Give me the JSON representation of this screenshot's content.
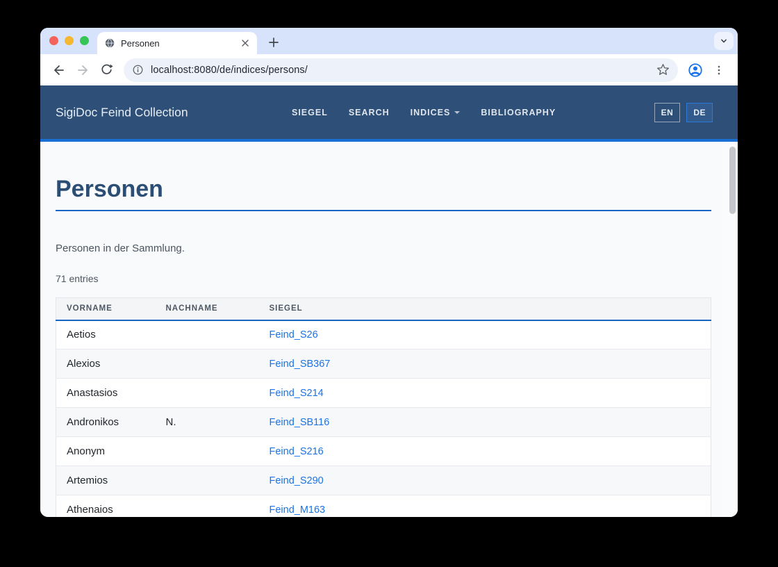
{
  "browser": {
    "tab_title": "Personen",
    "url": "localhost:8080/de/indices/persons/"
  },
  "site": {
    "brand": "SigiDoc Feind Collection",
    "nav": [
      {
        "label": "SIEGEL"
      },
      {
        "label": "SEARCH"
      },
      {
        "label": "INDICES",
        "has_dropdown": true
      },
      {
        "label": "BIBLIOGRAPHY"
      }
    ],
    "lang": [
      {
        "label": "EN",
        "active": false
      },
      {
        "label": "DE",
        "active": true
      }
    ]
  },
  "page": {
    "title": "Personen",
    "description": "Personen in der Sammlung.",
    "entries_count": "71 entries",
    "table": {
      "columns": [
        "VORNAME",
        "NACHNAME",
        "SIEGEL"
      ],
      "rows": [
        {
          "vorname": "Aetios",
          "nachname": "",
          "siegel": "Feind_S26"
        },
        {
          "vorname": "Alexios",
          "nachname": "",
          "siegel": "Feind_SB367"
        },
        {
          "vorname": "Anastasios",
          "nachname": "",
          "siegel": "Feind_S214"
        },
        {
          "vorname": "Andronikos",
          "nachname": "N.",
          "siegel": "Feind_SB116"
        },
        {
          "vorname": "Anonym",
          "nachname": "",
          "siegel": "Feind_S216"
        },
        {
          "vorname": "Artemios",
          "nachname": "",
          "siegel": "Feind_S290"
        },
        {
          "vorname": "Athenaios",
          "nachname": "",
          "siegel": "Feind_M163"
        }
      ]
    }
  },
  "icons": {
    "favicon": "globe-icon",
    "address_left": "info-icon",
    "address_right": "star-icon",
    "toolbar": [
      "back-icon",
      "forward-icon",
      "reload-icon",
      "profile-icon",
      "menu-dots-icon"
    ]
  },
  "colors": {
    "header_bg": "#2e5078",
    "header_accent": "#1a6fd4",
    "heading": "#2d4e74",
    "rule": "#1a66c2",
    "link": "#1a73e8",
    "tabstrip_bg": "#d7e3fa",
    "content_bg": "#f8fafc"
  }
}
